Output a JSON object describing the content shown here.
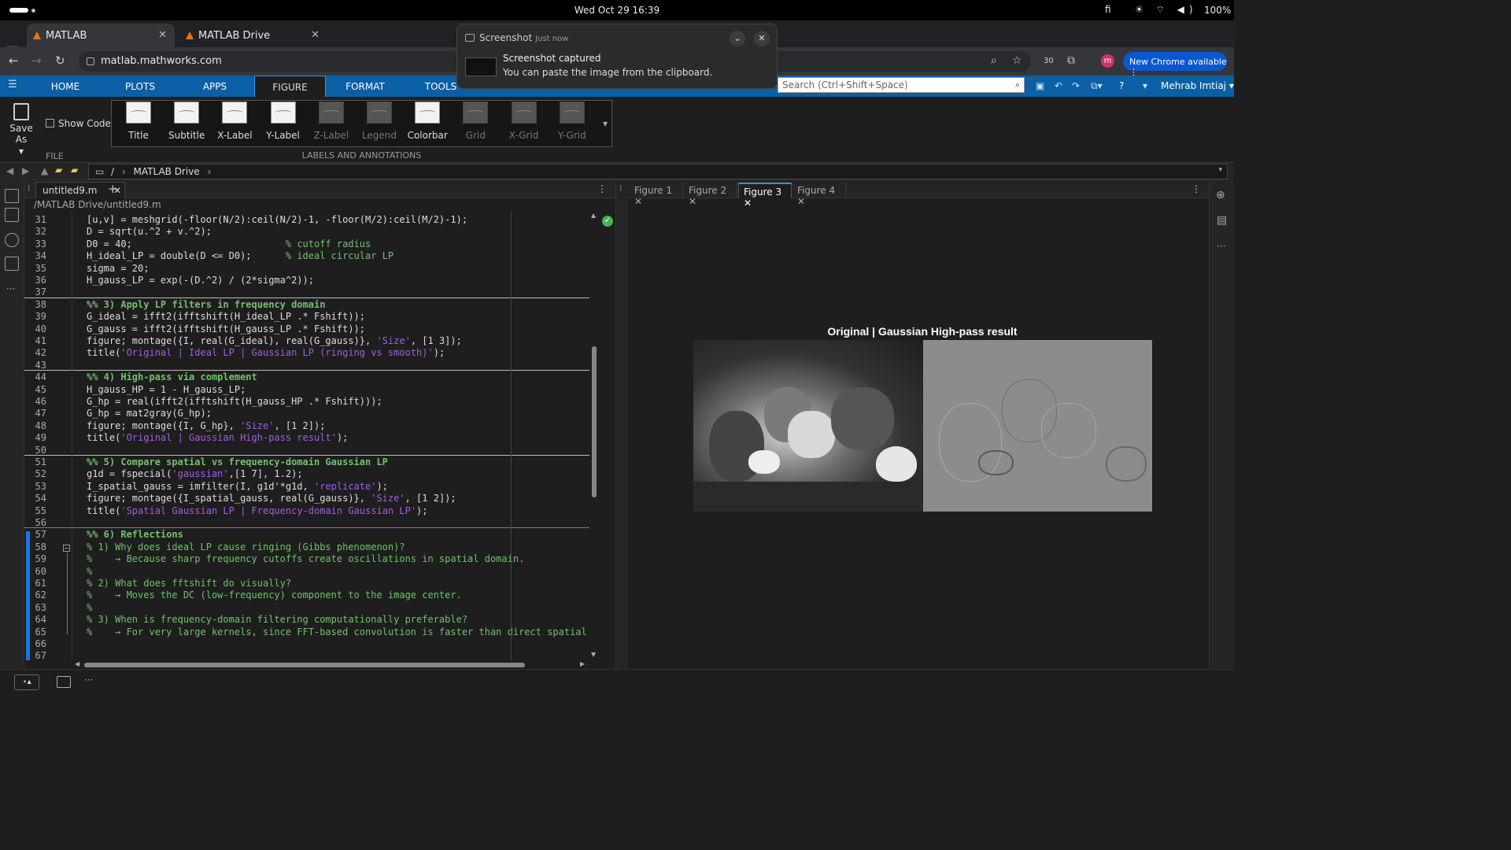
{
  "os": {
    "clock": "Wed Oct 29  16:39",
    "lang": "fi",
    "battery": "100%"
  },
  "browser": {
    "tabs": [
      {
        "label": "MATLAB"
      },
      {
        "label": "MATLAB Drive"
      }
    ],
    "url": "matlab.mathworks.com",
    "new_chrome": "New Chrome available",
    "profile_initial": "m",
    "ext_badge": "30"
  },
  "notification": {
    "app": "Screenshot",
    "when": "Just now",
    "title": "Screenshot captured",
    "body": "You can paste the image from the clipboard."
  },
  "toolstrip": {
    "tabs": [
      "HOME",
      "PLOTS",
      "APPS",
      "FIGURE",
      "FORMAT",
      "TOOLS"
    ],
    "selected_tab": "FIGURE",
    "search_placeholder": "Search (Ctrl+Shift+Space)",
    "user": "Mehrab Imtiaj"
  },
  "ribbon": {
    "save_as": "Save As",
    "show_code": "Show Code",
    "file_group": "FILE",
    "labels_group": "LABELS AND ANNOTATIONS",
    "buttons": [
      {
        "label": "Title",
        "enabled": true
      },
      {
        "label": "Subtitle",
        "enabled": true
      },
      {
        "label": "X-Label",
        "enabled": true
      },
      {
        "label": "Y-Label",
        "enabled": true
      },
      {
        "label": "Z-Label",
        "enabled": false
      },
      {
        "label": "Legend",
        "enabled": false
      },
      {
        "label": "Colorbar",
        "enabled": true
      },
      {
        "label": "Grid",
        "enabled": false
      },
      {
        "label": "X-Grid",
        "enabled": false
      },
      {
        "label": "Y-Grid",
        "enabled": false
      }
    ]
  },
  "path": {
    "root": "/",
    "folder": "MATLAB Drive"
  },
  "editor": {
    "tab": "untitled9.m",
    "file_path": "/MATLAB Drive/untitled9.m",
    "lines": [
      {
        "n": "31",
        "parts": [
          [
            "c",
            "[u,v] = meshgrid(-floor(N/2):ceil(N/2)-1, -floor(M/2):ceil(M/2)-1);"
          ]
        ]
      },
      {
        "n": "32",
        "parts": [
          [
            "c",
            "D = sqrt(u.^2 + v.^2);"
          ]
        ]
      },
      {
        "n": "33",
        "parts": [
          [
            "c",
            "D0 = 40;                           "
          ],
          [
            "m",
            "% cutoff radius"
          ]
        ]
      },
      {
        "n": "34",
        "parts": [
          [
            "c",
            "H_ideal_LP = double(D <= D0);      "
          ],
          [
            "m",
            "% ideal circular LP"
          ]
        ]
      },
      {
        "n": "35",
        "parts": [
          [
            "c",
            "sigma = 20;"
          ]
        ]
      },
      {
        "n": "36",
        "parts": [
          [
            "c",
            "H_gauss_LP = exp(-(D.^2) / (2*sigma^2));"
          ]
        ]
      },
      {
        "n": "37",
        "parts": []
      },
      {
        "n": "38",
        "parts": [
          [
            "h",
            "%% 3) Apply LP filters in frequency domain"
          ]
        ]
      },
      {
        "n": "39",
        "parts": [
          [
            "c",
            "G_ideal = ifft2(ifftshift(H_ideal_LP .* Fshift));"
          ]
        ]
      },
      {
        "n": "40",
        "parts": [
          [
            "c",
            "G_gauss = ifft2(ifftshift(H_gauss_LP .* Fshift));"
          ]
        ]
      },
      {
        "n": "41",
        "parts": [
          [
            "c",
            "figure; montage({I, real(G_ideal), real(G_gauss)}, "
          ],
          [
            "s",
            "'Size'"
          ],
          [
            "c",
            ", [1 3]);"
          ]
        ]
      },
      {
        "n": "42",
        "parts": [
          [
            "c",
            "title("
          ],
          [
            "s",
            "'Original | Ideal LP | Gaussian LP (ringing vs smooth)'"
          ],
          [
            "c",
            ");"
          ]
        ]
      },
      {
        "n": "43",
        "parts": []
      },
      {
        "n": "44",
        "parts": [
          [
            "h",
            "%% 4) High-pass via complement"
          ]
        ]
      },
      {
        "n": "45",
        "parts": [
          [
            "c",
            "H_gauss_HP = 1 - H_gauss_LP;"
          ]
        ]
      },
      {
        "n": "46",
        "parts": [
          [
            "c",
            "G_hp = real(ifft2(ifftshift(H_gauss_HP .* Fshift)));"
          ]
        ]
      },
      {
        "n": "47",
        "parts": [
          [
            "c",
            "G_hp = mat2gray(G_hp);"
          ]
        ]
      },
      {
        "n": "48",
        "parts": [
          [
            "c",
            "figure; montage({I, G_hp}, "
          ],
          [
            "s",
            "'Size'"
          ],
          [
            "c",
            ", [1 2]);"
          ]
        ]
      },
      {
        "n": "49",
        "parts": [
          [
            "c",
            "title("
          ],
          [
            "s",
            "'Original | Gaussian High-pass result'"
          ],
          [
            "c",
            ");"
          ]
        ]
      },
      {
        "n": "50",
        "parts": []
      },
      {
        "n": "51",
        "parts": [
          [
            "h",
            "%% 5) Compare spatial vs frequency-domain Gaussian LP"
          ]
        ]
      },
      {
        "n": "52",
        "parts": [
          [
            "c",
            "g1d = fspecial("
          ],
          [
            "s",
            "'gaussian'"
          ],
          [
            "c",
            ",[1 7], 1.2);"
          ]
        ]
      },
      {
        "n": "53",
        "parts": [
          [
            "c",
            "I_spatial_gauss = imfilter(I, g1d'*g1d, "
          ],
          [
            "s",
            "'replicate'"
          ],
          [
            "c",
            ");"
          ]
        ]
      },
      {
        "n": "54",
        "parts": [
          [
            "c",
            "figure; montage({I_spatial_gauss, real(G_gauss)}, "
          ],
          [
            "s",
            "'Size'"
          ],
          [
            "c",
            ", [1 2]);"
          ]
        ]
      },
      {
        "n": "55",
        "parts": [
          [
            "c",
            "title("
          ],
          [
            "s",
            "'Spatial Gaussian LP | Frequency-domain Gaussian LP'"
          ],
          [
            "c",
            ");"
          ]
        ]
      },
      {
        "n": "56",
        "parts": []
      },
      {
        "n": "57",
        "parts": [
          [
            "h",
            "%% 6) Reflections"
          ]
        ]
      },
      {
        "n": "58",
        "parts": [
          [
            "m",
            "% 1) Why does ideal LP cause ringing (Gibbs phenomenon)?"
          ]
        ]
      },
      {
        "n": "59",
        "parts": [
          [
            "m",
            "%    → Because sharp frequency cutoffs create oscillations in spatial domain."
          ]
        ]
      },
      {
        "n": "60",
        "parts": [
          [
            "m",
            "%"
          ]
        ]
      },
      {
        "n": "61",
        "parts": [
          [
            "m",
            "% 2) What does fftshift do visually?"
          ]
        ]
      },
      {
        "n": "62",
        "parts": [
          [
            "m",
            "%    → Moves the DC (low-frequency) component to the image center."
          ]
        ]
      },
      {
        "n": "63",
        "parts": [
          [
            "m",
            "%"
          ]
        ]
      },
      {
        "n": "64",
        "parts": [
          [
            "m",
            "% 3) When is frequency-domain filtering computationally preferable?"
          ]
        ]
      },
      {
        "n": "65",
        "parts": [
          [
            "m",
            "%    → For very large kernels, since FFT-based convolution is faster than direct spatial"
          ]
        ]
      },
      {
        "n": "66",
        "parts": []
      },
      {
        "n": "67",
        "parts": []
      }
    ]
  },
  "figures": {
    "tabs": [
      "Figure 1",
      "Figure 2",
      "Figure 3",
      "Figure 4"
    ],
    "selected": "Figure 3",
    "title": "Original | Gaussian High-pass result"
  },
  "colors": {
    "accent": "#0b5fa5",
    "comment": "#71c26b",
    "string": "#a25ee6"
  }
}
